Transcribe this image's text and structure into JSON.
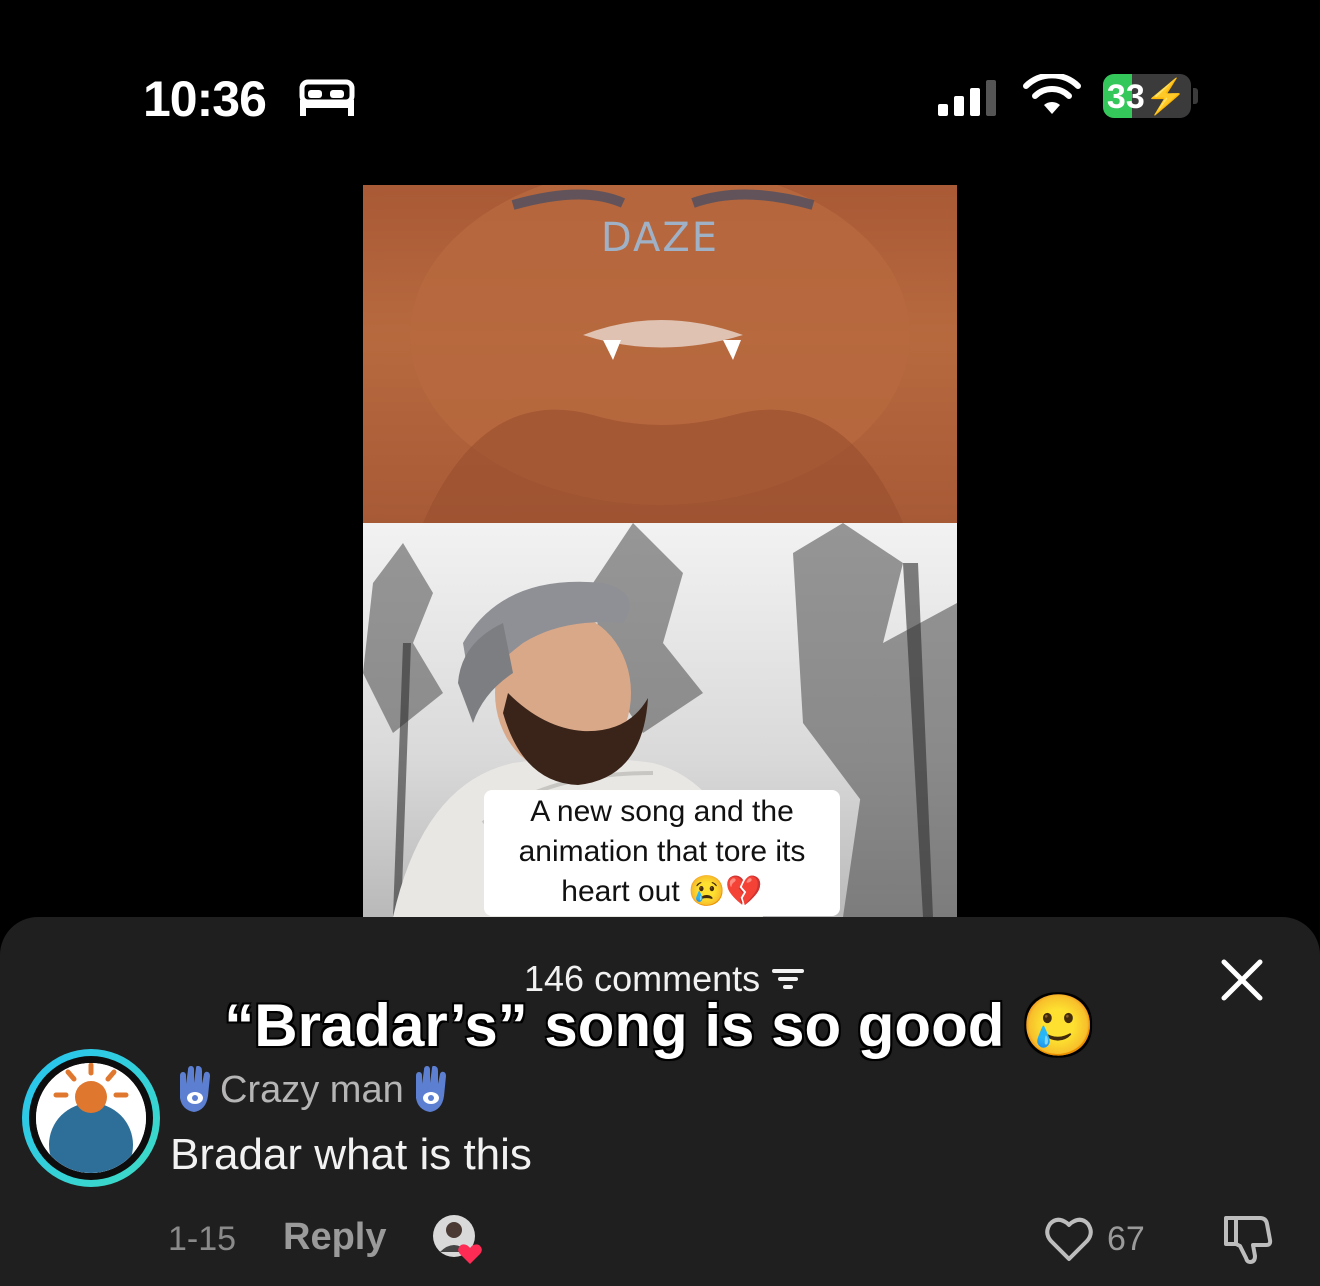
{
  "status_bar": {
    "time": "10:36",
    "battery_level": "33",
    "battery_fraction": 0.33,
    "icons": [
      "bed-icon",
      "signal-icon",
      "wifi-icon",
      "charging-bolt-icon"
    ]
  },
  "video": {
    "logo_text": "DAZE",
    "caption": "A new song and the animation that tore its heart out 😢💔"
  },
  "overlay_caption": "“Bradar’s” song is so good 🥲",
  "comments_sheet": {
    "count_label": "146 comments",
    "comment": {
      "username": "Crazy man",
      "text": "Bradar what is this",
      "date": "1-15",
      "reply_label": "Reply",
      "like_count": "67"
    }
  },
  "colors": {
    "sheet_bg": "#1f1f1f",
    "avatar_ring": "#27c3f2",
    "battery_green": "#34c759"
  }
}
